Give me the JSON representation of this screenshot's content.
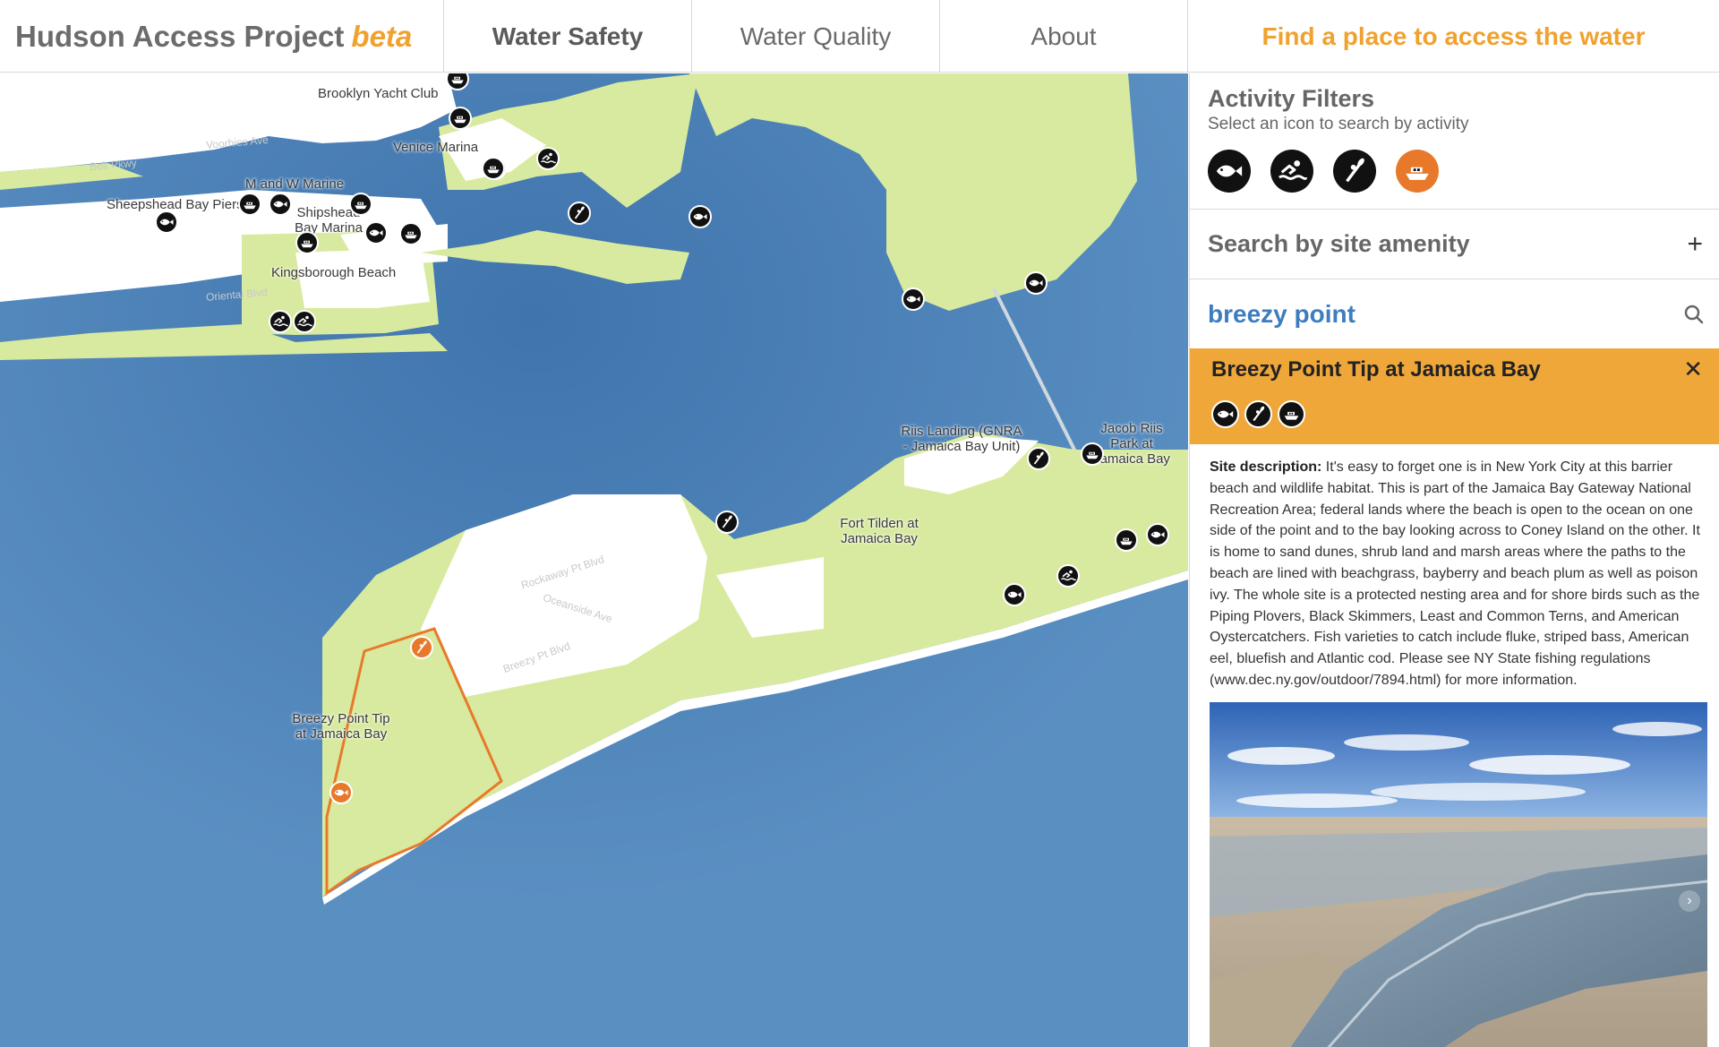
{
  "header": {
    "brand": "Hudson Access Project",
    "brand_tag": "beta",
    "tabs": [
      {
        "label": "Water Safety",
        "active": true
      },
      {
        "label": "Water Quality",
        "active": false
      },
      {
        "label": "About",
        "active": false
      }
    ],
    "cta": "Find a place to access the water"
  },
  "colors": {
    "accent_orange": "#f0a12e",
    "selected_orange": "#e8792a",
    "water": "#4f84b8",
    "land": "#d8ea9f",
    "link_blue": "#3d7dbf"
  },
  "map": {
    "labels": [
      "Brooklyn Yacht Club",
      "Venice Marina",
      "M and W Marine",
      "Sheepshead Bay Piers",
      "Shipshead Bay Marina",
      "Kingsborough Beach",
      "Riis Landing (GNRA - Jamaica Bay Unit)",
      "Jacob Riis Park at Jamaica Bay",
      "Fort Tilden at Jamaica Bay",
      "Breezy Point Tip at Jamaica Bay"
    ],
    "streets": [
      "Rockaway Pt Blvd",
      "Oceanside Ave",
      "Breezy Pt Blvd",
      "Oriental Blvd",
      "Voorhies Ave",
      "Belt Pkwy"
    ],
    "markers": [
      {
        "icon": "boat-icon",
        "selected": false
      },
      {
        "icon": "boat-icon",
        "selected": false
      },
      {
        "icon": "boat-icon",
        "selected": false
      },
      {
        "icon": "swim-icon",
        "selected": false
      },
      {
        "icon": "boat-icon",
        "selected": false
      },
      {
        "icon": "boat-icon",
        "selected": false
      },
      {
        "icon": "fish-icon",
        "selected": false
      },
      {
        "icon": "boat-icon",
        "selected": false
      },
      {
        "icon": "fish-icon",
        "selected": false
      },
      {
        "icon": "fish-icon",
        "selected": false
      },
      {
        "icon": "boat-icon",
        "selected": false
      },
      {
        "icon": "boat-icon",
        "selected": false
      },
      {
        "icon": "swim-icon",
        "selected": false
      },
      {
        "icon": "swim-icon",
        "selected": false
      },
      {
        "icon": "paddle-icon",
        "selected": false
      },
      {
        "icon": "fish-icon",
        "selected": false
      },
      {
        "icon": "fish-icon",
        "selected": false
      },
      {
        "icon": "fish-icon",
        "selected": false
      },
      {
        "icon": "paddle-icon",
        "selected": false
      },
      {
        "icon": "boat-icon",
        "selected": false
      },
      {
        "icon": "paddle-icon",
        "selected": false
      },
      {
        "icon": "boat-icon",
        "selected": false
      },
      {
        "icon": "fish-icon",
        "selected": false
      },
      {
        "icon": "swim-icon",
        "selected": false
      },
      {
        "icon": "fish-icon",
        "selected": false
      },
      {
        "icon": "paddle-icon",
        "selected": true
      },
      {
        "icon": "fish-icon",
        "selected": true
      }
    ]
  },
  "sidebar": {
    "filters_title": "Activity Filters",
    "filters_subtitle": "Select an icon to search by activity",
    "filters": [
      {
        "icon": "fish-icon",
        "selected": false
      },
      {
        "icon": "swim-icon",
        "selected": false
      },
      {
        "icon": "paddle-icon",
        "selected": false
      },
      {
        "icon": "boat-icon",
        "selected": true
      }
    ],
    "amenity_label": "Search by site amenity",
    "amenity_toggle": "+",
    "search_value": "breezy point",
    "result": {
      "title": "Breezy Point Tip at Jamaica Bay",
      "close": "✕",
      "icons": [
        "fish-icon",
        "paddle-icon",
        "boat-icon"
      ],
      "desc_label": "Site description:",
      "desc_text": " It's easy to forget one is in New York City at this barrier beach and wildlife habitat. This is part of the Jamaica Bay Gateway National Recreation Area; federal lands where the beach is open to the ocean on one side of the point and to the bay looking across to Coney Island on the other. It is home to sand dunes, shrub land and marsh areas where the paths to the beach are lined with beachgrass, bayberry and beach plum as well as poison ivy. The whole site is a protected nesting area and for shore birds such as the Piping Plovers, Black Skimmers, Least and Common Terns, and American Oystercatchers. Fish varieties to catch include fluke, striped bass, American eel, bluefish and Atlantic cod. Please see NY State fishing regulations (www.dec.ny.gov/outdoor/7894.html) for more information.",
      "photo_next": "›"
    }
  }
}
